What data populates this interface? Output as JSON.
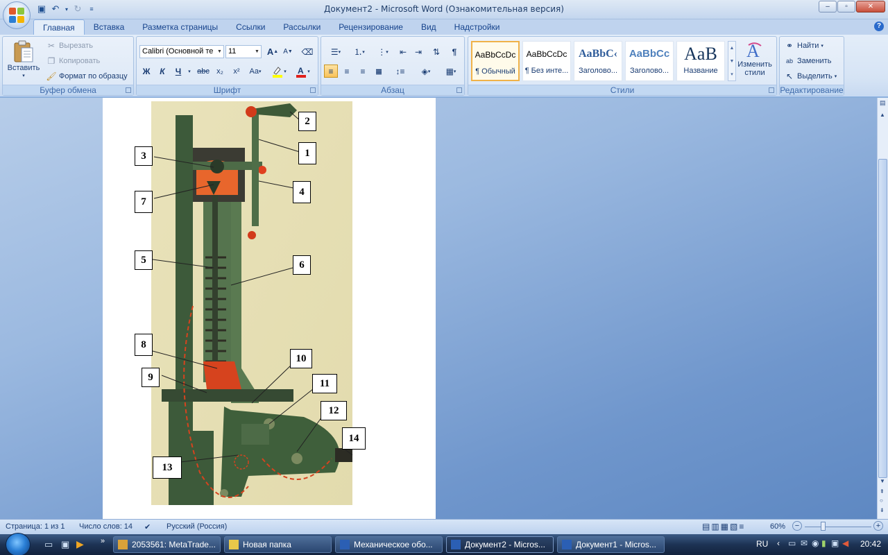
{
  "window": {
    "title": "Документ2 - Microsoft Word (Ознакомительная версия)",
    "controls": [
      "–",
      "▫",
      "✕"
    ]
  },
  "qat": [
    "save-icon",
    "undo-icon",
    "redo-icon",
    "customize-icon"
  ],
  "tabs": [
    {
      "label": "Главная",
      "active": true
    },
    {
      "label": "Вставка"
    },
    {
      "label": "Разметка страницы"
    },
    {
      "label": "Ссылки"
    },
    {
      "label": "Рассылки"
    },
    {
      "label": "Рецензирование"
    },
    {
      "label": "Вид"
    },
    {
      "label": "Надстройки"
    }
  ],
  "ribbon": {
    "clipboard": {
      "label": "Буфер обмена",
      "paste": "Вставить",
      "cut": "Вырезать",
      "copy": "Копировать",
      "format_painter": "Формат по образцу"
    },
    "font": {
      "label": "Шрифт",
      "font_name": "Calibri (Основной те",
      "font_size": "11",
      "bold": "Ж",
      "italic": "К",
      "underline": "Ч",
      "strike": "abc",
      "subscript": "x₂",
      "superscript": "x²",
      "change_case": "Aa",
      "grow": "A",
      "shrink": "A",
      "highlight_color": "#ffff00",
      "font_color": "#e0201b"
    },
    "paragraph": {
      "label": "Абзац",
      "pilcrow": "¶"
    },
    "styles": {
      "label": "Стили",
      "items": [
        {
          "sample": "AaBbCcDc",
          "name": "¶ Обычный",
          "active": true
        },
        {
          "sample": "AaBbCcDc",
          "name": "¶ Без инте..."
        },
        {
          "sample": "AaBbC‹",
          "name": "Заголово..."
        },
        {
          "sample": "AaBbCc",
          "name": "Заголово..."
        },
        {
          "sample": "AaB",
          "name": "Название"
        }
      ],
      "change_styles_line1": "Изменить",
      "change_styles_line2": "стили"
    },
    "editing": {
      "label": "Редактирование",
      "find": "Найти",
      "replace": "Заменить",
      "select": "Выделить"
    }
  },
  "figure": {
    "labels": [
      "1",
      "2",
      "3",
      "4",
      "5",
      "6",
      "7",
      "8",
      "9",
      "10",
      "11",
      "12",
      "13",
      "14"
    ]
  },
  "statusbar": {
    "page": "Страница: 1 из 1",
    "words": "Число слов: 14",
    "language": "Русский (Россия)",
    "zoom": "60%"
  },
  "taskbar": {
    "tasks": [
      {
        "label": "2053561: MetaTrade...",
        "icon_color": "#d9a23a"
      },
      {
        "label": "Новая папка",
        "icon_color": "#e8c84a"
      },
      {
        "label": "Механическое обо...",
        "icon_color": "#2b5fb4"
      },
      {
        "label": "Документ2 - Micros...",
        "icon_color": "#2b5fb4",
        "active": true
      },
      {
        "label": "Документ1 - Micros...",
        "icon_color": "#2b5fb4"
      }
    ],
    "language": "RU",
    "clock": "20:42"
  }
}
